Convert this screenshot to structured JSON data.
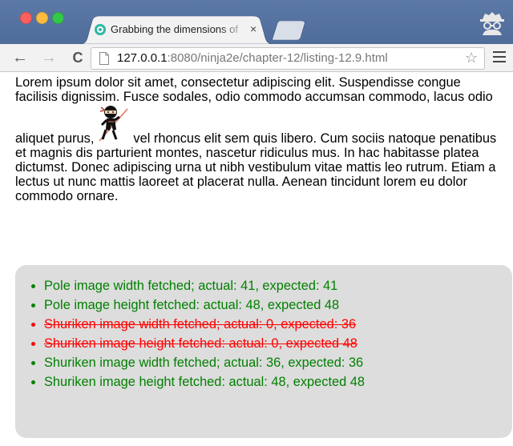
{
  "browser": {
    "tab": {
      "title": "Grabbing the dimensions of",
      "close_glyph": "×",
      "favicon": "ninja-favicon-icon"
    },
    "toolbar": {
      "back_glyph": "←",
      "forward_glyph": "→",
      "reload_glyph": "C",
      "url_host": "127.0.0.1",
      "url_rest": ":8080/ninja2e/chapter-12/listing-12.9.html",
      "star_glyph": "☆"
    }
  },
  "page": {
    "lorem_before": "Lorem ipsum dolor sit amet, consectetur adipiscing elit. Suspendisse congue facilisis dignissim. Fusce sodales, odio commodo accumsan commodo, lacus odio aliquet purus,",
    "lorem_after": "vel rhoncus elit sem quis libero. Cum sociis natoque penatibus et magnis dis parturient montes, nascetur ridiculus mus. In hac habitasse platea dictumst. Donec adipiscing urna ut nibh vestibulum vitae mattis leo rutrum. Etiam a lectus ut nunc mattis laoreet at placerat nulla. Aenean tincidunt lorem eu dolor commodo ornare.",
    "results": [
      {
        "text": "Pole image width fetched; actual: 41, expected: 41",
        "status": "pass"
      },
      {
        "text": "Pole image height fetched: actual: 48, expected 48",
        "status": "pass"
      },
      {
        "text": "Shuriken image width fetched; actual: 0, expected: 36",
        "status": "fail"
      },
      {
        "text": "Shuriken image height fetched: actual: 0, expected 48",
        "status": "fail"
      },
      {
        "text": "Shuriken image width fetched; actual: 36, expected: 36",
        "status": "pass"
      },
      {
        "text": "Shuriken image height fetched: actual: 48, expected 48",
        "status": "pass"
      }
    ]
  },
  "colors": {
    "pass": "#008000",
    "fail": "#ff0000",
    "results_bg": "#dddddd",
    "tabstrip": "#5c79a6"
  }
}
